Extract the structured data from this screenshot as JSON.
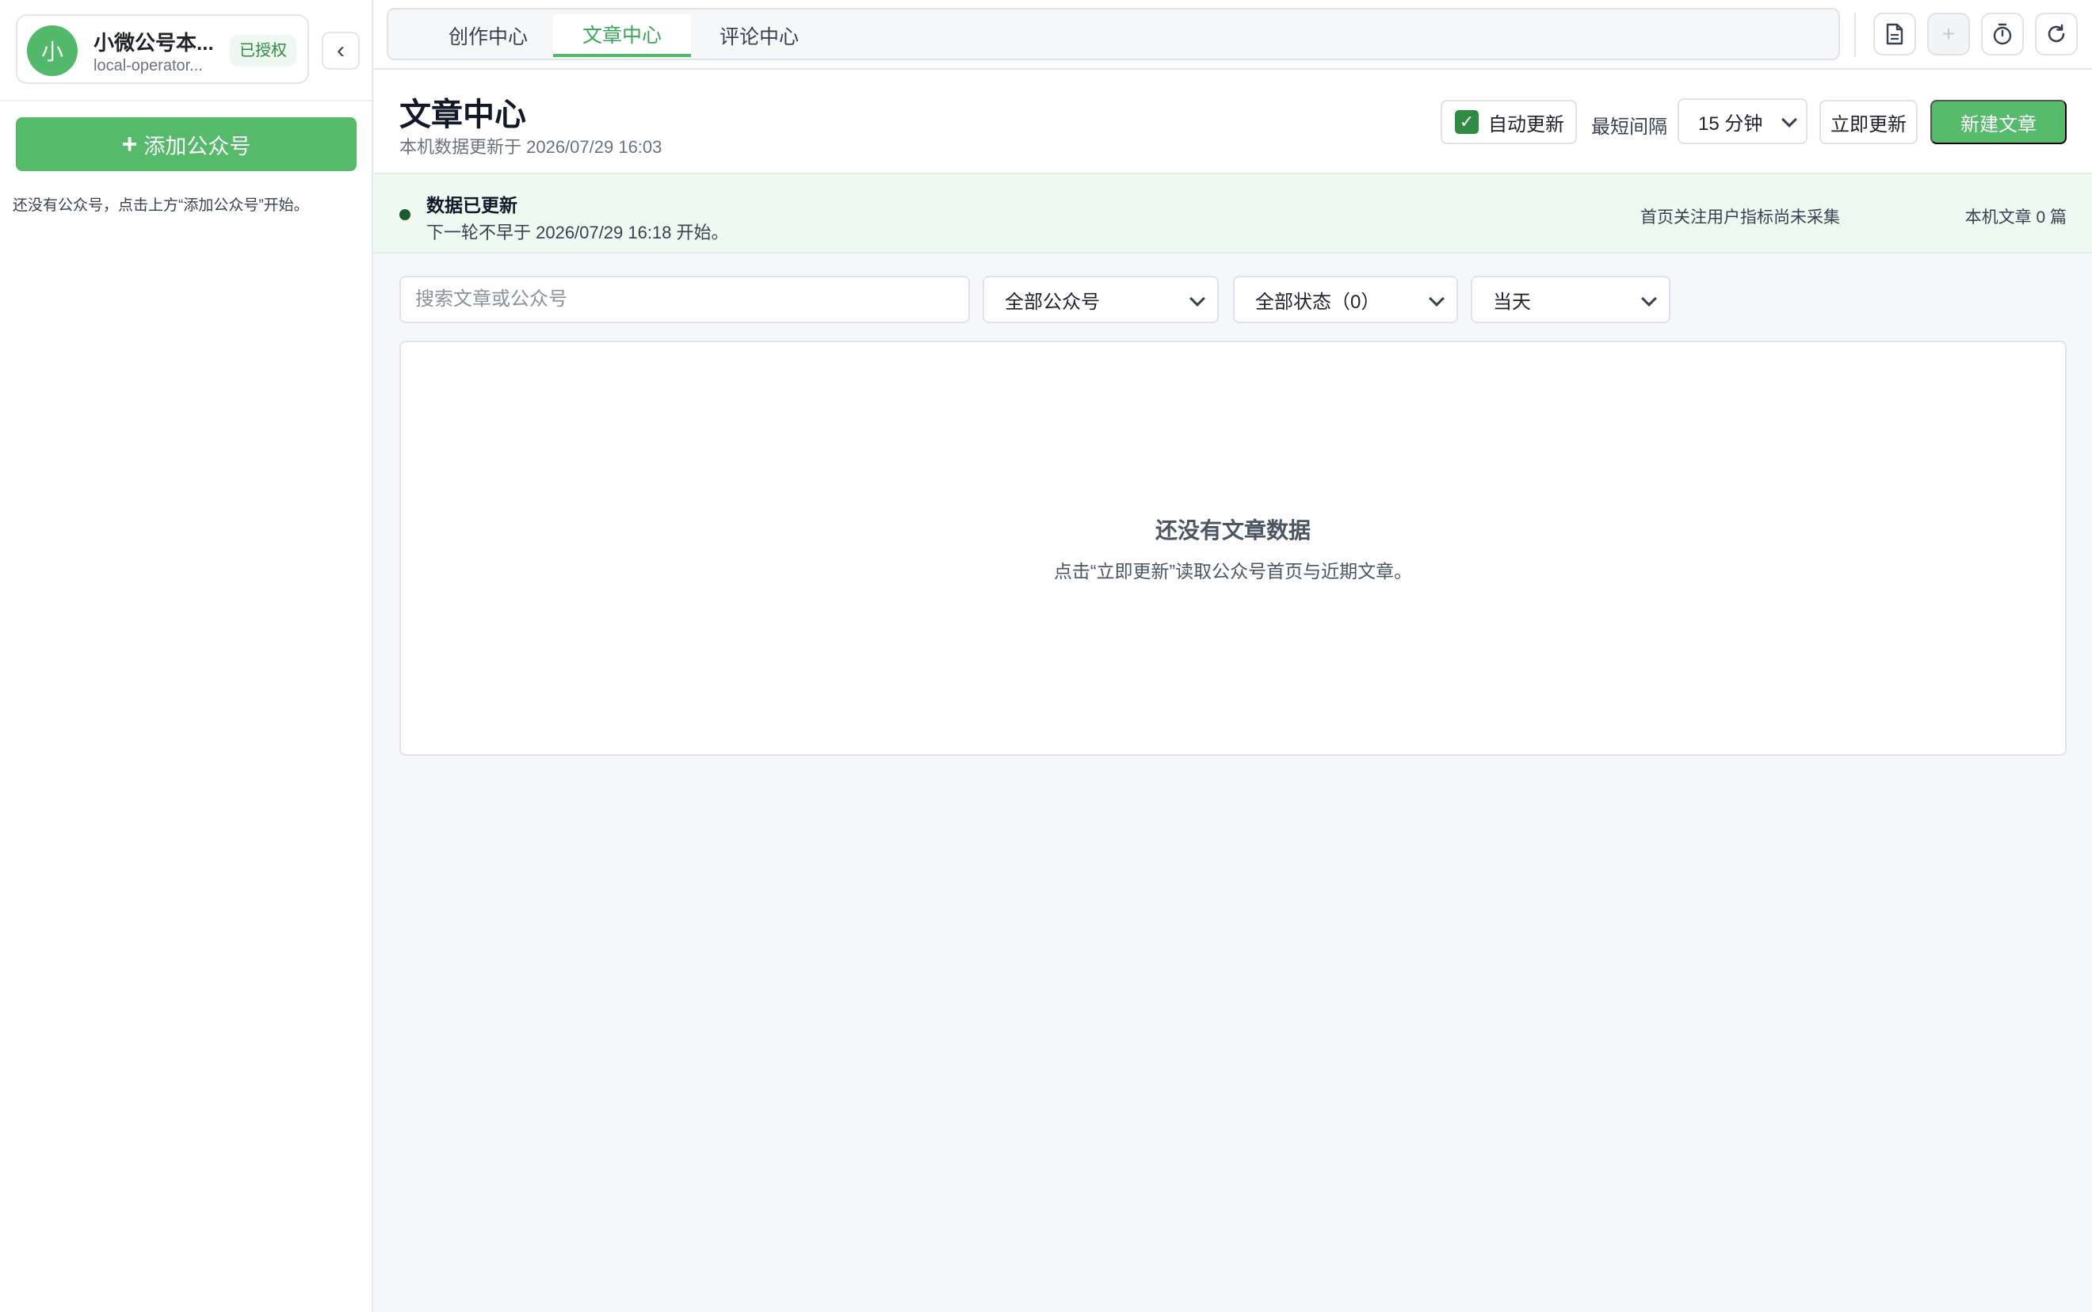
{
  "sidebar": {
    "account": {
      "avatar_text": "小",
      "name": "小微公号本...",
      "id": "local-operator...",
      "badge": "已授权"
    },
    "collapse_icon": "chevron-left-icon",
    "add_button_label": "添加公众号",
    "hint": "还没有公众号，点击上方“添加公众号”开始。"
  },
  "topbar": {
    "tabs": [
      {
        "label": "创作中心",
        "active": false
      },
      {
        "label": "文章中心",
        "active": true
      },
      {
        "label": "评论中心",
        "active": false
      }
    ],
    "icons": [
      "document-icon",
      "plus-icon",
      "timer-icon",
      "refresh-icon"
    ]
  },
  "header": {
    "title": "文章中心",
    "subtitle": "本机数据更新于 2026/07/29 16:03",
    "auto_update_label": "自动更新",
    "auto_update_checked": true,
    "interval_label": "最短间隔",
    "interval_value": "15 分钟",
    "refresh_now_label": "立即更新",
    "new_article_label": "新建文章"
  },
  "status": {
    "title": "数据已更新",
    "desc": "下一轮不早于 2026/07/29 16:18 开始。",
    "metric_followers": "首页关注用户指标尚未采集",
    "metric_articles": "本机文章 0 篇"
  },
  "filters": {
    "search_placeholder": "搜索文章或公众号",
    "account_select": "全部公众号",
    "status_select": "全部状态（0）",
    "date_select": "当天"
  },
  "empty": {
    "title": "还没有文章数据",
    "desc": "点击“立即更新”读取公众号首页与近期文章。"
  },
  "colors": {
    "accent": "#55bb6b",
    "accent_dark": "#2f8a44",
    "banner_bg": "#eefaf1"
  }
}
